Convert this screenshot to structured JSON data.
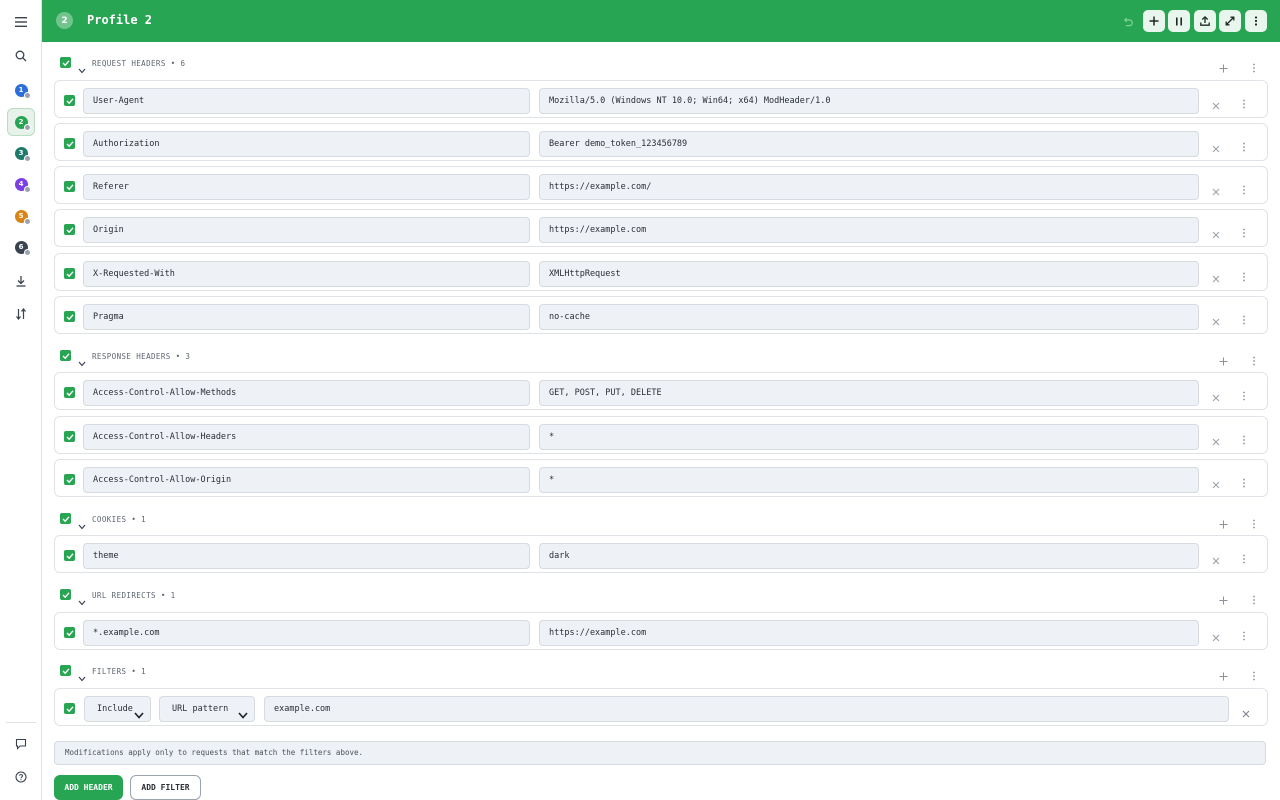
{
  "header": {
    "profile_number": "2",
    "profile_name": "Profile 2",
    "accent_color": "#27a552"
  },
  "sidebar": {
    "items": [
      {
        "icon": "menu-icon"
      },
      {
        "icon": "search-icon"
      },
      {
        "profile": "1",
        "color": "#2d6fd9"
      },
      {
        "profile": "2",
        "color": "#27a552"
      },
      {
        "profile": "3",
        "color": "#1f7a6b"
      },
      {
        "profile": "4",
        "color": "#7b3fe4"
      },
      {
        "profile": "5",
        "color": "#d88416"
      },
      {
        "profile": "6",
        "color": "#3a4250"
      },
      {
        "icon": "download-icon"
      },
      {
        "icon": "sort-arrows-icon"
      },
      {
        "icon": "chat-icon"
      },
      {
        "icon": "help-icon"
      }
    ]
  },
  "sections": {
    "request": {
      "title": "REQUEST HEADERS",
      "count": "6",
      "rows": [
        {
          "name": "User-Agent",
          "value": "Mozilla/5.0 (Windows NT 10.0; Win64; x64) ModHeader/1.0"
        },
        {
          "name": "Authorization",
          "value": "Bearer demo_token_123456789"
        },
        {
          "name": "Referer",
          "value": "https://example.com/"
        },
        {
          "name": "Origin",
          "value": "https://example.com"
        },
        {
          "name": "X-Requested-With",
          "value": "XMLHttpRequest"
        },
        {
          "name": "Pragma",
          "value": "no-cache"
        }
      ]
    },
    "response": {
      "title": "RESPONSE HEADERS",
      "count": "3",
      "rows": [
        {
          "name": "Access-Control-Allow-Methods",
          "value": "GET, POST, PUT, DELETE"
        },
        {
          "name": "Access-Control-Allow-Headers",
          "value": "*"
        },
        {
          "name": "Access-Control-Allow-Origin",
          "value": "*"
        }
      ]
    },
    "cookies": {
      "title": "COOKIES",
      "count": "1",
      "rows": [
        {
          "name": "theme",
          "value": "dark"
        }
      ]
    },
    "redirects": {
      "title": "URL REDIRECTS",
      "count": "1",
      "rows": [
        {
          "name": "*.example.com",
          "value": "https://example.com"
        }
      ]
    },
    "filters": {
      "title": "FILTERS",
      "count": "1",
      "rows": [
        {
          "mode": "Include",
          "type": "URL pattern",
          "value": "example.com"
        }
      ]
    }
  },
  "note": "Modifications apply only to requests that match the filters above.",
  "buttons": {
    "add_header": "ADD HEADER",
    "add_filter": "ADD FILTER"
  }
}
